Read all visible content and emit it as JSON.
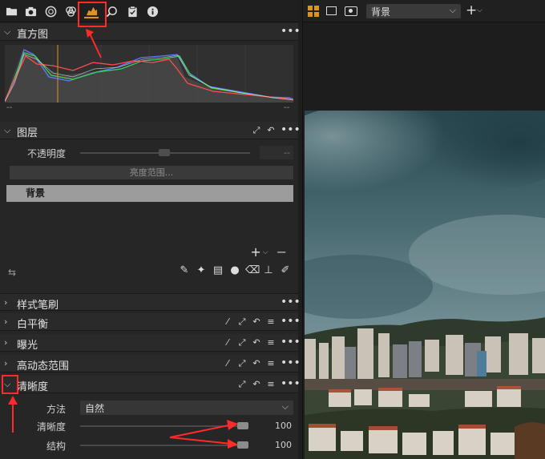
{
  "left_panel": {
    "histogram": {
      "title": "直方图",
      "tick_left": "--",
      "tick_right": "--"
    },
    "layers": {
      "title": "图层",
      "opacity_label": "不透明度",
      "opacity_value": "--",
      "luma_range_label": "亮度范围...",
      "layer_name": "背景"
    },
    "collapsed_sections": [
      "样式笔刷",
      "白平衡",
      "曝光",
      "高动态范围"
    ],
    "clarity": {
      "title": "清晰度",
      "method_label": "方法",
      "method_value": "自然",
      "clarity_label": "清晰度",
      "clarity_value": "100",
      "structure_label": "结构",
      "structure_value": "100"
    }
  },
  "right_panel": {
    "variant_select_value": "背景"
  },
  "colors": {
    "accent": "#e0921f",
    "annotation": "#ff2a2a",
    "panel_bg": "#262626"
  }
}
